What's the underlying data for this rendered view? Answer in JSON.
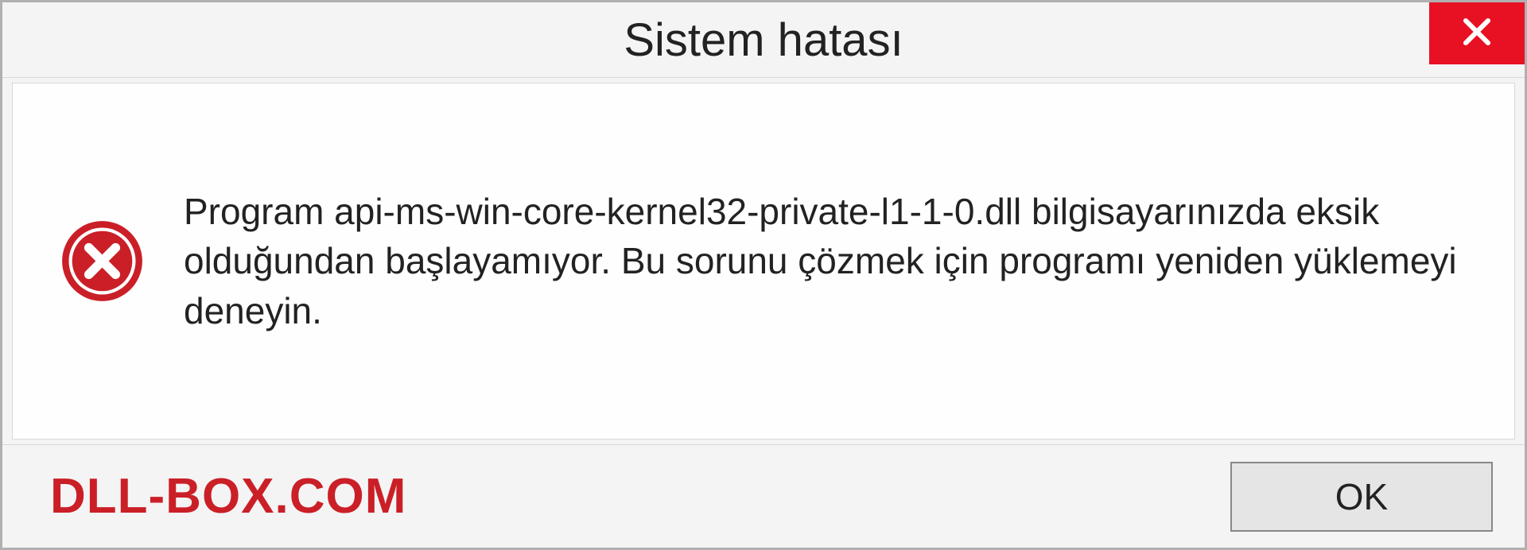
{
  "titlebar": {
    "title": "Sistem hatası"
  },
  "content": {
    "message": "Program api-ms-win-core-kernel32-private-l1-1-0.dll bilgisayarınızda eksik olduğundan başlayamıyor. Bu sorunu çözmek için programı yeniden yüklemeyi deneyin."
  },
  "footer": {
    "watermark": "DLL-BOX.COM",
    "ok_label": "OK"
  },
  "colors": {
    "close_bg": "#e81123",
    "error_icon": "#ca1f27",
    "watermark": "#ca1f27"
  }
}
